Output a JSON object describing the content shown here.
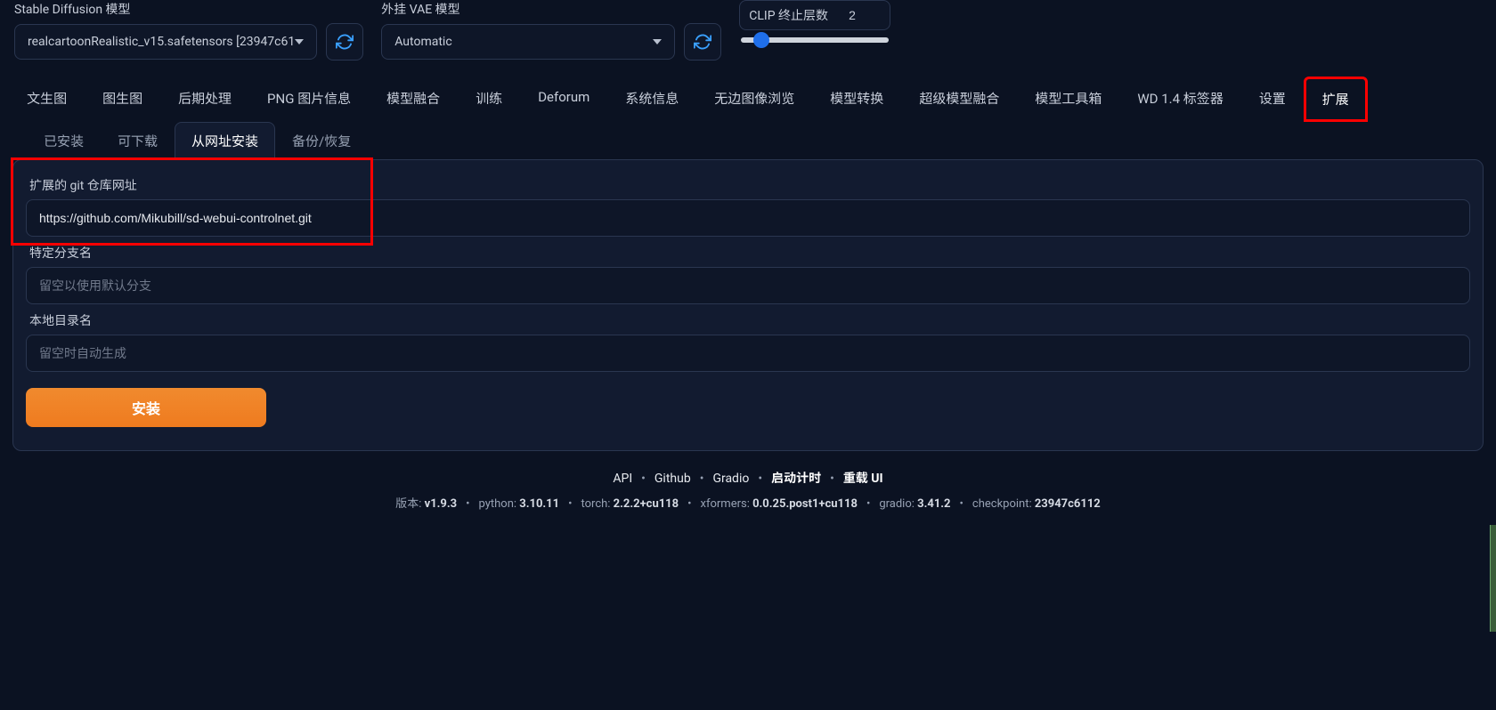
{
  "top": {
    "sd_model_label": "Stable Diffusion 模型",
    "sd_model_value": "realcartoonRealistic_v15.safetensors [23947c61",
    "vae_label": "外挂 VAE 模型",
    "vae_value": "Automatic",
    "clip_label": "CLIP 终止层数",
    "clip_value": "2",
    "clip_min": 1,
    "clip_max": 12
  },
  "main_tabs": [
    "文生图",
    "图生图",
    "后期处理",
    "PNG 图片信息",
    "模型融合",
    "训练",
    "Deforum",
    "系统信息",
    "无边图像浏览",
    "模型转换",
    "超级模型融合",
    "模型工具箱",
    "WD 1.4 标签器",
    "设置",
    "扩展"
  ],
  "main_tab_active_index": 14,
  "sub_tabs": [
    "已安装",
    "可下载",
    "从网址安装",
    "备份/恢复"
  ],
  "sub_tab_active_index": 2,
  "form": {
    "git_url_label": "扩展的 git 仓库网址",
    "git_url_value": "https://github.com/Mikubill/sd-webui-controlnet.git",
    "branch_label": "特定分支名",
    "branch_placeholder": "留空以使用默认分支",
    "branch_value": "",
    "local_dir_label": "本地目录名",
    "local_dir_placeholder": "留空时自动生成",
    "local_dir_value": "",
    "install_label": "安装"
  },
  "footer": {
    "links": [
      "API",
      "Github",
      "Gradio",
      "启动计时",
      "重载 UI"
    ],
    "bold_link_indices": [
      3,
      4
    ],
    "meta_pairs": [
      [
        "版本",
        "v1.9.3"
      ],
      [
        "python",
        "3.10.11"
      ],
      [
        "torch",
        "2.2.2+cu118"
      ],
      [
        "xformers",
        "0.0.25.post1+cu118"
      ],
      [
        "gradio",
        "3.41.2"
      ],
      [
        "checkpoint",
        "23947c6112"
      ]
    ]
  }
}
